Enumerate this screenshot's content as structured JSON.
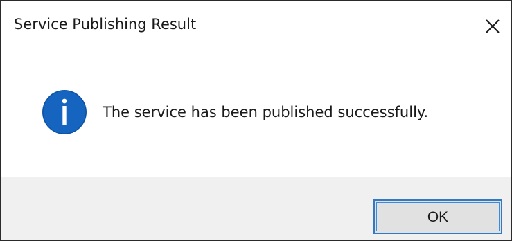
{
  "dialog": {
    "title": "Service Publishing Result",
    "message": "The service has been published successfully.",
    "icon": "info-icon",
    "close_icon": "close-icon",
    "ok_label": "OK"
  },
  "colors": {
    "info_icon_fill": "#1565c0",
    "ok_button_border": "#2f79c6",
    "footer_background": "#f0f0f0"
  }
}
